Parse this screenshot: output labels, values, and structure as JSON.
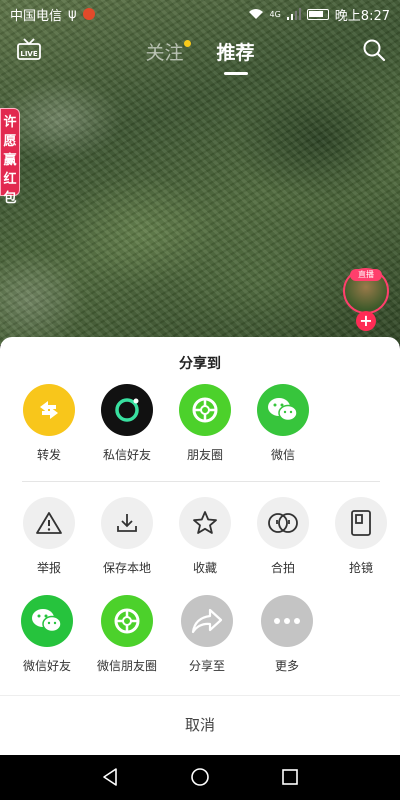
{
  "status_bar": {
    "carrier": "中国电信",
    "usb_icon": "usb-icon",
    "network_type": "4G",
    "time": "晚上8:27"
  },
  "top_nav": {
    "live_icon": "LIVE",
    "tabs": [
      {
        "label": "关注",
        "active": false,
        "has_dot": true
      },
      {
        "label": "推荐",
        "active": true,
        "has_dot": false
      }
    ],
    "search_icon": "search-icon"
  },
  "overlay": {
    "pendant_text": [
      "许",
      "愿",
      "赢",
      "红",
      "包"
    ],
    "live_tag": "直播",
    "follow_plus": "+"
  },
  "share_sheet": {
    "title": "分享到",
    "row1": [
      {
        "label": "转发",
        "icon": "repost-icon",
        "color": "#f8c61b"
      },
      {
        "label": "私信好友",
        "icon": "message-icon",
        "color": "#111111"
      },
      {
        "label": "朋友圈",
        "icon": "moments-icon",
        "color": "#4cd12b"
      },
      {
        "label": "微信",
        "icon": "wechat-icon",
        "color": "#37c53c"
      }
    ],
    "row2": [
      {
        "label": "举报",
        "icon": "report-icon",
        "color": "#efefef"
      },
      {
        "label": "保存本地",
        "icon": "download-icon",
        "color": "#efefef"
      },
      {
        "label": "收藏",
        "icon": "star-icon",
        "color": "#efefef"
      },
      {
        "label": "合拍",
        "icon": "duet-icon",
        "color": "#efefef"
      },
      {
        "label": "抢镜",
        "icon": "react-icon",
        "color": "#efefef"
      }
    ],
    "row3": [
      {
        "label": "微信好友",
        "icon": "wechat-icon",
        "color": "#26c33d"
      },
      {
        "label": "微信朋友圈",
        "icon": "moments-icon",
        "color": "#4cd12b"
      },
      {
        "label": "分享至",
        "icon": "share-icon",
        "color": "#c4c4c4"
      },
      {
        "label": "更多",
        "icon": "more-icon",
        "color": "#c4c4c4"
      }
    ],
    "cancel": "取消"
  },
  "system_nav": {
    "back": "back-icon",
    "home": "home-icon",
    "recent": "recent-apps-icon"
  }
}
